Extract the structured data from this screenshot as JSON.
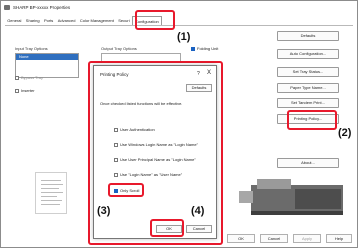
{
  "window": {
    "title": "SHARP BP-xxxxx Properties"
  },
  "tabs": [
    "General",
    "Sharing",
    "Ports",
    "Advanced",
    "Color Management",
    "Securi",
    "Configuration"
  ],
  "left_panel": {
    "input_tray_label": "Input Tray Options",
    "list_items": [
      "None"
    ],
    "bypass_tray_label": "Bypass Tray",
    "inserter_label": "Inserter"
  },
  "output": {
    "label": "Output Tray Options",
    "folding_unit_label": "Folding Unit"
  },
  "right_buttons": {
    "defaults": "Defaults",
    "auto_config": "Auto Configuration...",
    "set_tray": "Set Tray Status...",
    "paper_type": "Paper Type Name...",
    "tandem": "Set Tandem Print...",
    "printing_policy": "Printing Policy...",
    "about": "About..."
  },
  "footer": {
    "ok": "OK",
    "cancel": "Cancel",
    "apply": "Apply",
    "help": "Help"
  },
  "dialog": {
    "title": "Printing Policy",
    "help_glyph": "?",
    "close_glyph": "X",
    "defaults": "Defaults",
    "notice": "Once checked listed functions will be effective.",
    "options": [
      {
        "label": "User Authentication",
        "checked": false
      },
      {
        "label": "Use Windows Login Name as \"Login Name\"",
        "checked": false
      },
      {
        "label": "Use User Principal Name as \"Login Name\"",
        "checked": false
      },
      {
        "label": "Use \"Login Name\" as \"User Name\"",
        "checked": false
      },
      {
        "label": "Only Scroll",
        "checked": true
      }
    ],
    "ok": "OK",
    "cancel": "Cancel"
  },
  "callouts": [
    "(1)",
    "(2)",
    "(3)",
    "(4)"
  ],
  "colors": {
    "callout": "#e8192c",
    "selection": "#2f6fbf",
    "checked": "#1a62c2"
  }
}
